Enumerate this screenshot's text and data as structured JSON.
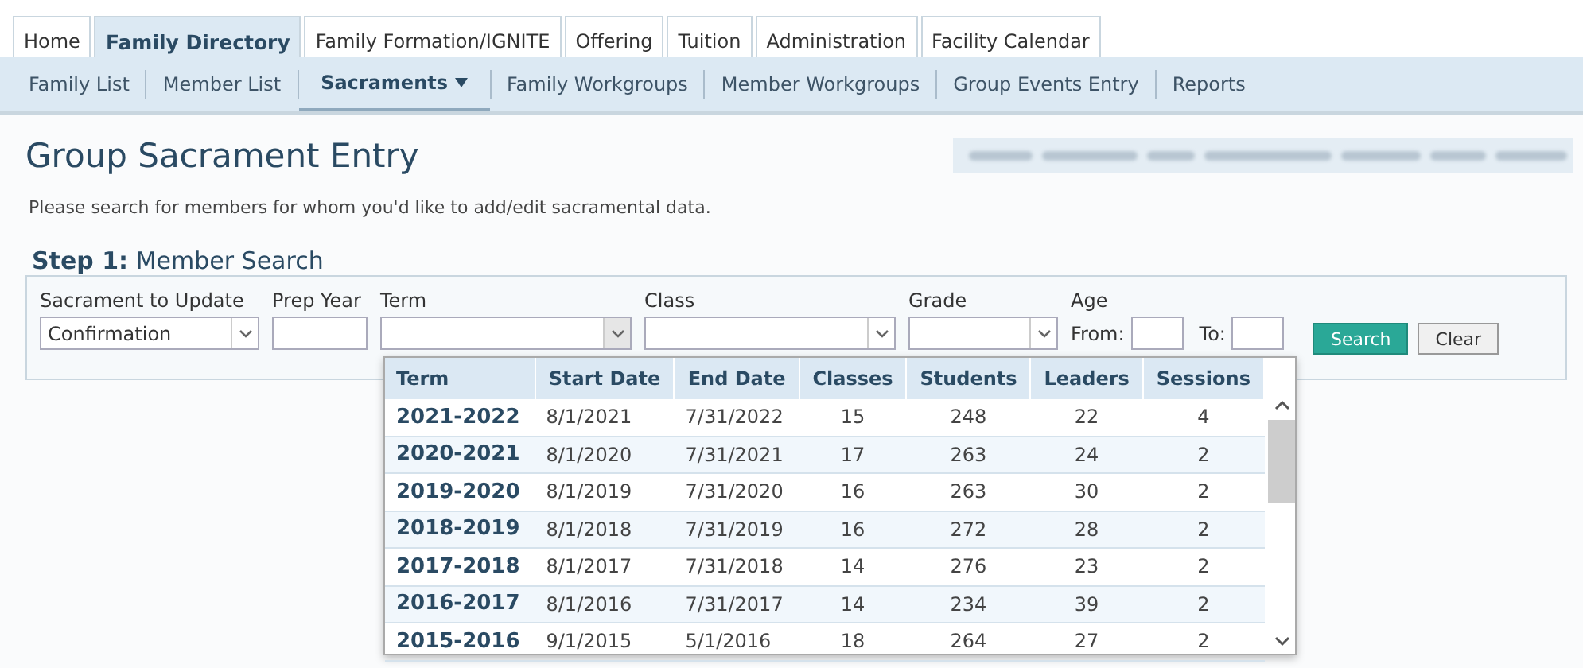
{
  "tabs": [
    {
      "label": "Home",
      "selected": false
    },
    {
      "label": "Family Directory",
      "selected": true
    },
    {
      "label": "Family Formation/IGNITE",
      "selected": false
    },
    {
      "label": "Offering",
      "selected": false
    },
    {
      "label": "Tuition",
      "selected": false
    },
    {
      "label": "Administration",
      "selected": false
    },
    {
      "label": "Facility Calendar",
      "selected": false
    }
  ],
  "subnav": [
    {
      "label": "Family List",
      "selected": false,
      "dropdown": false
    },
    {
      "label": "Member List",
      "selected": false,
      "dropdown": false
    },
    {
      "label": "Sacraments",
      "selected": true,
      "dropdown": true
    },
    {
      "label": "Family Workgroups",
      "selected": false,
      "dropdown": false
    },
    {
      "label": "Member Workgroups",
      "selected": false,
      "dropdown": false
    },
    {
      "label": "Group Events Entry",
      "selected": false,
      "dropdown": false
    },
    {
      "label": "Reports",
      "selected": false,
      "dropdown": false
    }
  ],
  "page_title": "Group Sacrament Entry",
  "instructions": "Please search for members for whom you'd like to add/edit sacramental data.",
  "step": {
    "number": "Step 1:",
    "title": "Member Search"
  },
  "fields": [
    {
      "kind": "select",
      "label": "Sacrament to Update",
      "value": "Confirmation"
    },
    {
      "kind": "input",
      "label": "Prep Year"
    },
    {
      "kind": "select",
      "label": "Term",
      "expanded": true
    },
    {
      "kind": "select",
      "label": "Class"
    },
    {
      "kind": "select",
      "label": "Grade"
    },
    {
      "kind": "age",
      "label": "Age",
      "from_label": "From:",
      "to_label": "To:"
    }
  ],
  "buttons": [
    {
      "label": "Search",
      "kind": "primary"
    },
    {
      "label": "Clear",
      "kind": "secondary"
    }
  ],
  "term_dropdown": {
    "columns": [
      "Term",
      "Start Date",
      "End Date",
      "Classes",
      "Students",
      "Leaders",
      "Sessions"
    ],
    "rows": [
      [
        "2021-2022",
        "8/1/2021",
        "7/31/2022",
        "15",
        "248",
        "22",
        "4"
      ],
      [
        "2020-2021",
        "8/1/2020",
        "7/31/2021",
        "17",
        "263",
        "24",
        "2"
      ],
      [
        "2019-2020",
        "8/1/2019",
        "7/31/2020",
        "16",
        "263",
        "30",
        "2"
      ],
      [
        "2018-2019",
        "8/1/2018",
        "7/31/2019",
        "16",
        "272",
        "28",
        "2"
      ],
      [
        "2017-2018",
        "8/1/2017",
        "7/31/2018",
        "14",
        "276",
        "23",
        "2"
      ],
      [
        "2016-2017",
        "8/1/2016",
        "7/31/2017",
        "14",
        "234",
        "39",
        "2"
      ],
      [
        "2015-2016",
        "9/1/2015",
        "5/1/2016",
        "18",
        "264",
        "27",
        "2"
      ]
    ]
  }
}
